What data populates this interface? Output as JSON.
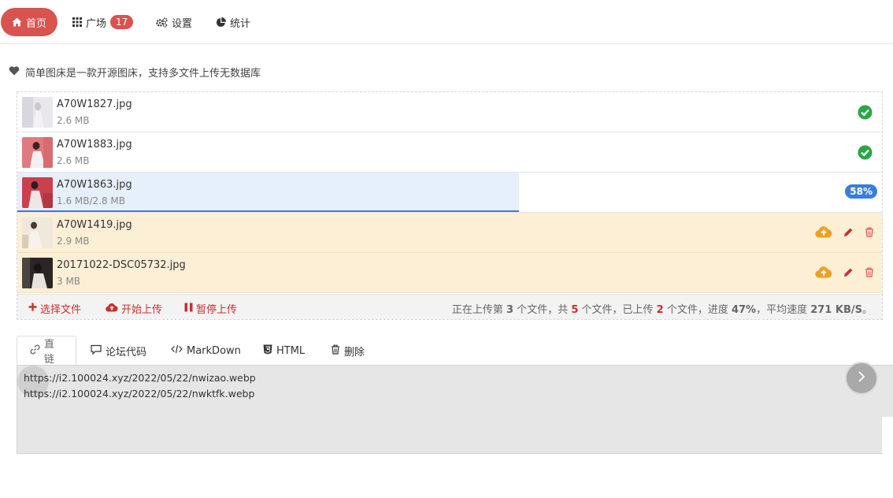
{
  "nav": {
    "home": "首页",
    "square": "广场",
    "square_badge": "17",
    "settings": "设置",
    "stats": "统计"
  },
  "intro": "简单图床是一款开源图床，支持多文件上传无数据库",
  "files": [
    {
      "name": "A70W1827.jpg",
      "size": "2.6 MB",
      "status": "done"
    },
    {
      "name": "A70W1883.jpg",
      "size": "2.6 MB",
      "status": "done"
    },
    {
      "name": "A70W1863.jpg",
      "size": "1.6 MB/2.8 MB",
      "status": "uploading",
      "progress": 58,
      "progress_label": "58%"
    },
    {
      "name": "A70W1419.jpg",
      "size": "2.9 MB",
      "status": "pending"
    },
    {
      "name": "20171022-DSC05732.jpg",
      "size": "3 MB",
      "status": "pending"
    }
  ],
  "uploader": {
    "select_label": "选择文件",
    "start_label": "开始上传",
    "pause_label": "暂停上传",
    "stat": {
      "p1": "正在上传第 ",
      "current": "3",
      "p2": " 个文件，共 ",
      "total": "5",
      "p3": " 个文件，已上传 ",
      "uploaded": "2",
      "p4": " 个文件，进度 ",
      "progress": "47%",
      "p5": "，平均速度 ",
      "speed": "271 KB/S",
      "p6": "。"
    }
  },
  "tabs": [
    {
      "label": "直链",
      "icon": "link-icon",
      "active": true
    },
    {
      "label": "论坛代码",
      "icon": "comment-icon"
    },
    {
      "label": "MarkDown",
      "icon": "code-icon"
    },
    {
      "label": "HTML",
      "icon": "html5-icon"
    },
    {
      "label": "删除",
      "icon": "trash-icon"
    }
  ],
  "links": [
    "https://i2.100024.xyz/2022/05/22/nwizao.webp",
    "https://i2.100024.xyz/2022/05/22/nwktfk.webp"
  ],
  "colors": {
    "accent": "#d9534f",
    "success": "#28a745",
    "info": "#3a7ddc",
    "warning": "#f0a020"
  }
}
